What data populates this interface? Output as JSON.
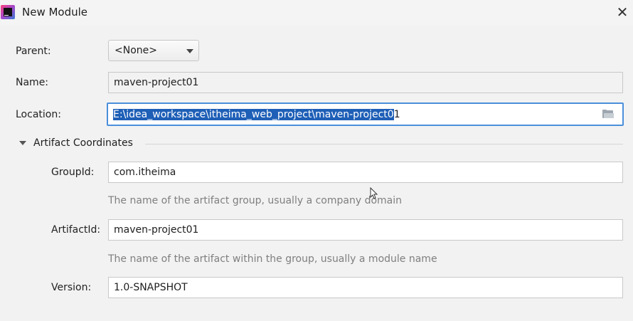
{
  "window": {
    "title": "New Module",
    "app_icon": "intellij-idea-icon",
    "close_glyph": "✕"
  },
  "form": {
    "parent": {
      "label": "Parent:",
      "value": "<None>"
    },
    "name": {
      "label": "Name:",
      "value": "maven-project01"
    },
    "location": {
      "label": "Location:",
      "value_selected": "E:\\idea_workspace\\itheima_web_project\\maven-project0",
      "value_rest": "1",
      "icon": "folder-icon"
    }
  },
  "artifact": {
    "section_title": "Artifact Coordinates",
    "group_id": {
      "label": "GroupId:",
      "value": "com.itheima",
      "hint": "The name of the artifact group, usually a company domain"
    },
    "artifact_id": {
      "label": "ArtifactId:",
      "value": "maven-project01",
      "hint": "The name of the artifact within the group, usually a module name"
    },
    "version": {
      "label": "Version:",
      "value": "1.0-SNAPSHOT"
    }
  },
  "colors": {
    "selection": "#1e5fb7",
    "focus_border": "#4a8fdb",
    "background": "#f2f2f2"
  }
}
